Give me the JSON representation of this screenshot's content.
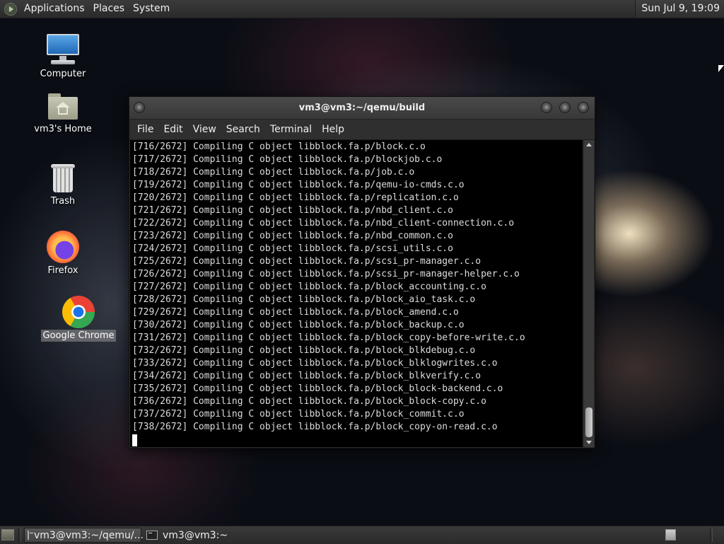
{
  "top_panel": {
    "menus": [
      "Applications",
      "Places",
      "System"
    ],
    "clock": "Sun Jul  9, 19:09"
  },
  "desktop": {
    "icons": [
      {
        "label": "Computer",
        "icon": "computer-icon"
      },
      {
        "label": "vm3's Home",
        "icon": "home-folder-icon"
      },
      {
        "label": "Trash",
        "icon": "trash-icon"
      },
      {
        "label": "Firefox",
        "icon": "firefox-icon"
      },
      {
        "label": "Google Chrome",
        "icon": "chrome-icon"
      }
    ]
  },
  "terminal": {
    "title": "vm3@vm3:~/qemu/build",
    "menu": [
      "File",
      "Edit",
      "View",
      "Search",
      "Terminal",
      "Help"
    ],
    "lines": [
      "[716/2672] Compiling C object libblock.fa.p/block.c.o",
      "[717/2672] Compiling C object libblock.fa.p/blockjob.c.o",
      "[718/2672] Compiling C object libblock.fa.p/job.c.o",
      "[719/2672] Compiling C object libblock.fa.p/qemu-io-cmds.c.o",
      "[720/2672] Compiling C object libblock.fa.p/replication.c.o",
      "[721/2672] Compiling C object libblock.fa.p/nbd_client.c.o",
      "[722/2672] Compiling C object libblock.fa.p/nbd_client-connection.c.o",
      "[723/2672] Compiling C object libblock.fa.p/nbd_common.c.o",
      "[724/2672] Compiling C object libblock.fa.p/scsi_utils.c.o",
      "[725/2672] Compiling C object libblock.fa.p/scsi_pr-manager.c.o",
      "[726/2672] Compiling C object libblock.fa.p/scsi_pr-manager-helper.c.o",
      "[727/2672] Compiling C object libblock.fa.p/block_accounting.c.o",
      "[728/2672] Compiling C object libblock.fa.p/block_aio_task.c.o",
      "[729/2672] Compiling C object libblock.fa.p/block_amend.c.o",
      "[730/2672] Compiling C object libblock.fa.p/block_backup.c.o",
      "[731/2672] Compiling C object libblock.fa.p/block_copy-before-write.c.o",
      "[732/2672] Compiling C object libblock.fa.p/block_blkdebug.c.o",
      "[733/2672] Compiling C object libblock.fa.p/block_blklogwrites.c.o",
      "[734/2672] Compiling C object libblock.fa.p/block_blkverify.c.o",
      "[735/2672] Compiling C object libblock.fa.p/block_block-backend.c.o",
      "[736/2672] Compiling C object libblock.fa.p/block_block-copy.c.o",
      "[737/2672] Compiling C object libblock.fa.p/block_commit.c.o",
      "[738/2672] Compiling C object libblock.fa.p/block_copy-on-read.c.o"
    ]
  },
  "taskbar": {
    "tasks": [
      {
        "label": "vm3@vm3:~/qemu/...",
        "active": true
      },
      {
        "label": "vm3@vm3:~",
        "active": false
      }
    ]
  }
}
